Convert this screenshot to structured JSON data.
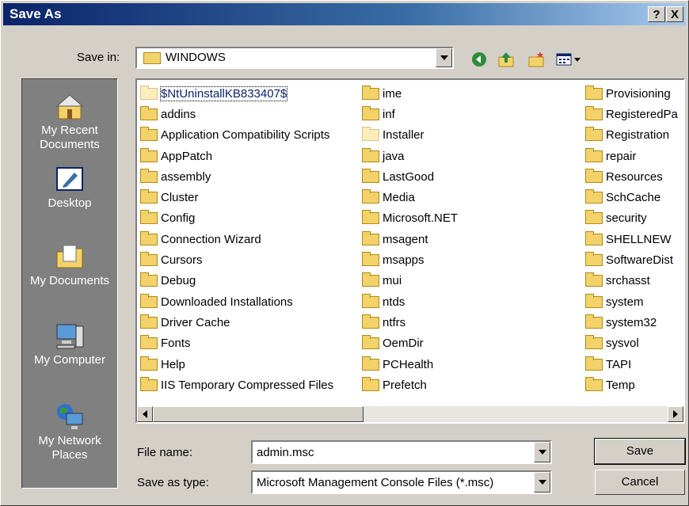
{
  "window": {
    "title": "Save As"
  },
  "titlebar_buttons": {
    "help": "?",
    "close": "X"
  },
  "save_in": {
    "label": "Save in:",
    "value": "WINDOWS"
  },
  "places": [
    {
      "label": "My Recent Documents",
      "icon": "recent-documents-icon"
    },
    {
      "label": "Desktop",
      "icon": "desktop-icon"
    },
    {
      "label": "My Documents",
      "icon": "my-documents-icon"
    },
    {
      "label": "My Computer",
      "icon": "my-computer-icon"
    },
    {
      "label": "My Network Places",
      "icon": "network-places-icon"
    }
  ],
  "files": {
    "col1": [
      "$NtUninstallKB833407$",
      "addins",
      "Application Compatibility Scripts",
      "AppPatch",
      "assembly",
      "Cluster",
      "Config",
      "Connection Wizard",
      "Cursors",
      "Debug",
      "Downloaded Installations",
      "Driver Cache",
      "Fonts",
      "Help",
      "IIS Temporary Compressed Files"
    ],
    "col2": [
      "ime",
      "inf",
      "Installer",
      "java",
      "LastGood",
      "Media",
      "Microsoft.NET",
      "msagent",
      "msapps",
      "mui",
      "ntds",
      "ntfrs",
      "OemDir",
      "PCHealth",
      "Prefetch"
    ],
    "col3": [
      "Provisioning",
      "RegisteredPa",
      "Registration",
      "repair",
      "Resources",
      "SchCache",
      "security",
      "SHELLNEW",
      "SoftwareDist",
      "srchasst",
      "system",
      "system32",
      "sysvol",
      "TAPI",
      "Temp"
    ]
  },
  "file_name": {
    "label": "File name:",
    "value": "admin.msc"
  },
  "save_as_type": {
    "label": "Save as type:",
    "value": "Microsoft Management Console Files (*.msc)"
  },
  "buttons": {
    "save": "Save",
    "cancel": "Cancel"
  }
}
